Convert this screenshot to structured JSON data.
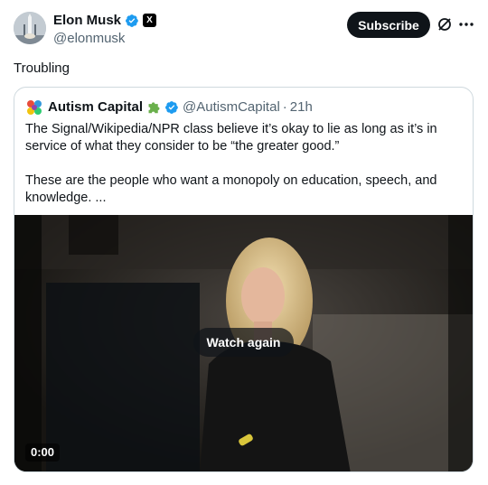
{
  "author": {
    "name": "Elon Musk",
    "handle": "@elonmusk",
    "x_badge": "X",
    "avatar_icon": "avatar-rocket-launch",
    "verified_icon": "verified-badge-icon"
  },
  "actions": {
    "subscribe_label": "Subscribe",
    "grok_icon": "grok-icon",
    "more_icon": "more-icon"
  },
  "tweet": {
    "text": "Troubling"
  },
  "quote": {
    "name": "Autism Capital",
    "handle": "@AutismCapital",
    "separator": "·",
    "time": "21h",
    "logo_icon": "autism-capital-logo",
    "puzzle_icon": "puzzle-piece-icon",
    "paragraph1": "The Signal/Wikipedia/NPR class believe it’s okay to lie as long as it’s in service of what they consider to be “the greater good.”",
    "paragraph2": "These are the people who want a monopoly on education, speech, and knowledge. ..."
  },
  "media": {
    "watch_again_label": "Watch again",
    "timestamp": "0:00"
  },
  "colors": {
    "text_primary": "#0f1419",
    "text_secondary": "#536471",
    "verified_blue": "#1d9bf0",
    "border": "#cfd9de",
    "puzzle_green": "#6ab04c"
  }
}
